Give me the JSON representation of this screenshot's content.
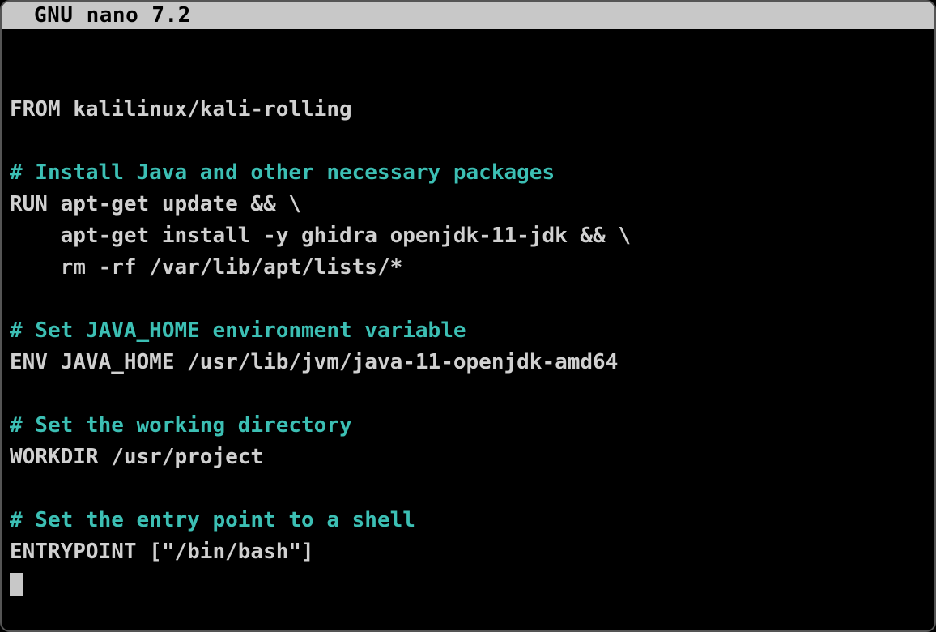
{
  "title_bar": {
    "app_name": "GNU nano 7.2"
  },
  "lines": [
    {
      "segments": [
        {
          "class": "keyword",
          "text": "FROM kalilinux/kali-rolling"
        }
      ]
    },
    {
      "segments": [
        {
          "class": "text-default",
          "text": " "
        }
      ]
    },
    {
      "segments": [
        {
          "class": "comment",
          "text": "# Install Java and other necessary packages"
        }
      ]
    },
    {
      "segments": [
        {
          "class": "keyword",
          "text": "RUN apt-get update && \\"
        }
      ]
    },
    {
      "segments": [
        {
          "class": "keyword",
          "text": "    apt-get install -y ghidra openjdk-11-jdk && \\"
        }
      ]
    },
    {
      "segments": [
        {
          "class": "keyword",
          "text": "    rm -rf /var/lib/apt/lists/*"
        }
      ]
    },
    {
      "segments": [
        {
          "class": "text-default",
          "text": " "
        }
      ]
    },
    {
      "segments": [
        {
          "class": "comment",
          "text": "# Set JAVA_HOME environment variable"
        }
      ]
    },
    {
      "segments": [
        {
          "class": "keyword",
          "text": "ENV JAVA_HOME /usr/lib/jvm/java-11-openjdk-amd64"
        }
      ]
    },
    {
      "segments": [
        {
          "class": "text-default",
          "text": " "
        }
      ]
    },
    {
      "segments": [
        {
          "class": "comment",
          "text": "# Set the working directory"
        }
      ]
    },
    {
      "segments": [
        {
          "class": "keyword",
          "text": "WORKDIR /usr/project"
        }
      ]
    },
    {
      "segments": [
        {
          "class": "text-default",
          "text": " "
        }
      ]
    },
    {
      "segments": [
        {
          "class": "comment",
          "text": "# Set the entry point to a shell"
        }
      ]
    },
    {
      "segments": [
        {
          "class": "keyword",
          "text": "ENTRYPOINT [\"/bin/bash\"]"
        }
      ]
    }
  ]
}
